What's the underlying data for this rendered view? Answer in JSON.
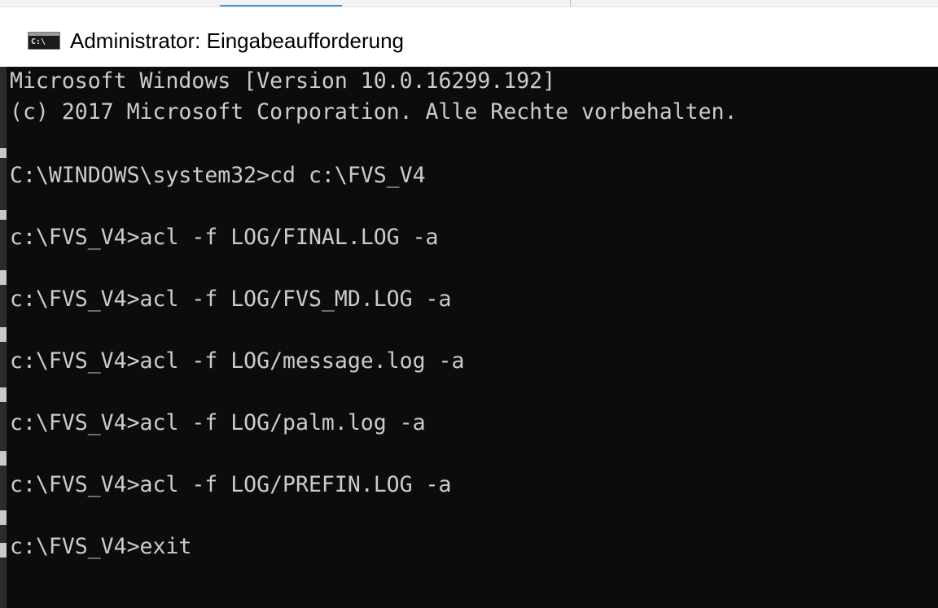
{
  "window": {
    "title": "Administrator: Eingabeaufforderung",
    "icon": "cmd-console-icon",
    "icon_text": "C:\\"
  },
  "console": {
    "background": "#0c0c0c",
    "foreground": "#cccccc",
    "lines": [
      "Microsoft Windows [Version 10.0.16299.192]",
      "(c) 2017 Microsoft Corporation. Alle Rechte vorbehalten.",
      "",
      "C:\\WINDOWS\\system32>cd c:\\FVS_V4",
      "",
      "c:\\FVS_V4>acl -f LOG/FINAL.LOG -a",
      "",
      "c:\\FVS_V4>acl -f LOG/FVS_MD.LOG -a",
      "",
      "c:\\FVS_V4>acl -f LOG/message.log -a",
      "",
      "c:\\FVS_V4>acl -f LOG/palm.log -a",
      "",
      "c:\\FVS_V4>acl -f LOG/PREFIN.LOG -a",
      "",
      "c:\\FVS_V4>exit"
    ]
  }
}
